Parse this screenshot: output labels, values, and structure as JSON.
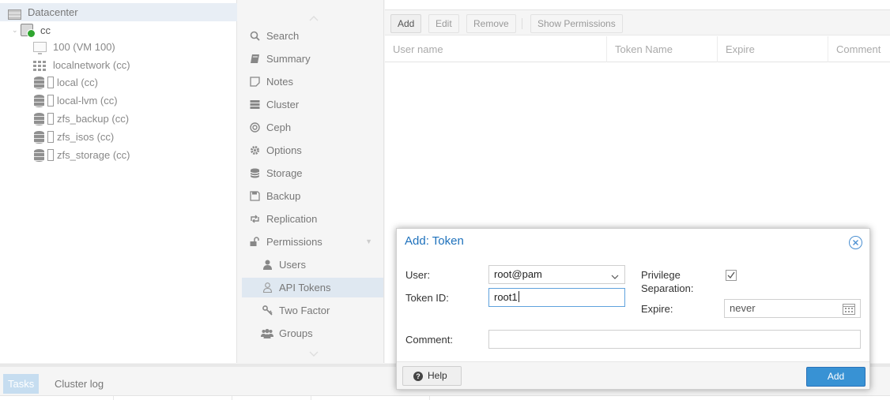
{
  "tree": {
    "items": [
      {
        "label": "Datacenter"
      },
      {
        "label": "cc"
      },
      {
        "label": "100 (VM 100)"
      },
      {
        "label": "localnetwork (cc)"
      },
      {
        "label": "local (cc)"
      },
      {
        "label": "local-lvm (cc)"
      },
      {
        "label": "zfs_backup (cc)"
      },
      {
        "label": "zfs_isos (cc)"
      },
      {
        "label": "zfs_storage (cc)"
      }
    ]
  },
  "nav": {
    "items": [
      {
        "label": "Search",
        "icon": "search-icon"
      },
      {
        "label": "Summary",
        "icon": "book-icon"
      },
      {
        "label": "Notes",
        "icon": "sticky-note-icon"
      },
      {
        "label": "Cluster",
        "icon": "server-icon"
      },
      {
        "label": "Ceph",
        "icon": "ceph-icon"
      },
      {
        "label": "Options",
        "icon": "gear-icon"
      },
      {
        "label": "Storage",
        "icon": "database-icon"
      },
      {
        "label": "Backup",
        "icon": "floppy-icon"
      },
      {
        "label": "Replication",
        "icon": "retweet-icon"
      },
      {
        "label": "Permissions",
        "icon": "unlock-icon"
      },
      {
        "label": "Users",
        "icon": "user-icon"
      },
      {
        "label": "API Tokens",
        "icon": "user-outline-icon"
      },
      {
        "label": "Two Factor",
        "icon": "key-icon"
      },
      {
        "label": "Groups",
        "icon": "users-icon"
      }
    ]
  },
  "toolbar": {
    "add": "Add",
    "edit": "Edit",
    "remove": "Remove",
    "show_permissions": "Show Permissions"
  },
  "grid": {
    "columns": [
      "User name",
      "Token Name",
      "Expire",
      "Comment"
    ]
  },
  "bottom": {
    "tabs": [
      "Tasks",
      "Cluster log"
    ]
  },
  "dialog": {
    "title": "Add: Token",
    "user_label": "User:",
    "user_value": "root@pam",
    "token_id_label": "Token ID:",
    "token_id_value": "root1",
    "privsep_label_1": "Privilege",
    "privsep_label_2": "Separation:",
    "privsep_checked": true,
    "expire_label": "Expire:",
    "expire_value": "never",
    "comment_label": "Comment:",
    "comment_value": "",
    "help_button": "Help",
    "add_button": "Add"
  },
  "colors": {
    "accent": "#3892d4",
    "title_blue": "#1e71bc",
    "selection": "#dfe8f1",
    "active_tab": "#c6ddf0"
  }
}
